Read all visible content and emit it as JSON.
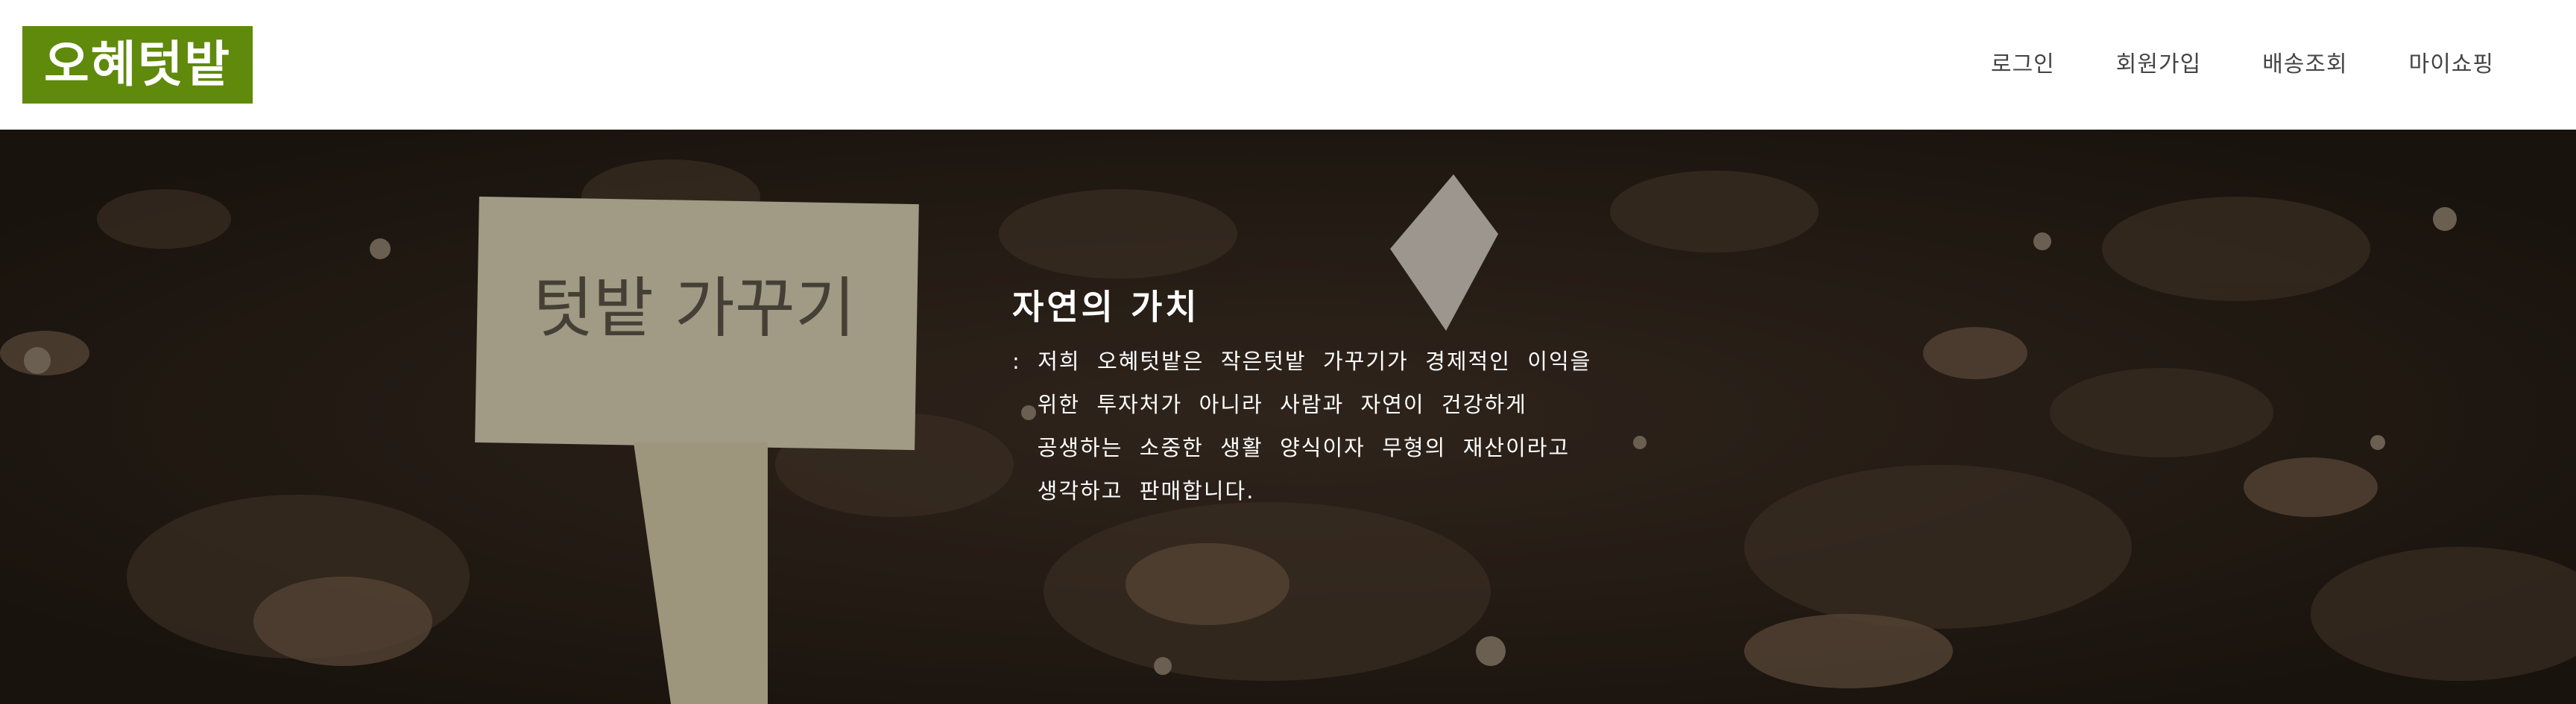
{
  "header": {
    "logo_text": "오혜텃밭",
    "brand_color": "#5f8a0b",
    "nav": [
      {
        "label": "로그인"
      },
      {
        "label": "회원가입"
      },
      {
        "label": "배송조회"
      },
      {
        "label": "마이쇼핑"
      }
    ]
  },
  "hero": {
    "title": "자연의 가치",
    "lines": [
      ":  저희  오혜텃밭은  작은텃밭  가꾸기가  경제적인  이익을",
      "   위한  투자처가  아니라  사람과  자연이  건강하게",
      "   공생하는  소중한  생활  양식이자  무형의  재산이라고",
      "   생각하고  판매합니다."
    ],
    "sign_text": "텃밭 가꾸기"
  }
}
